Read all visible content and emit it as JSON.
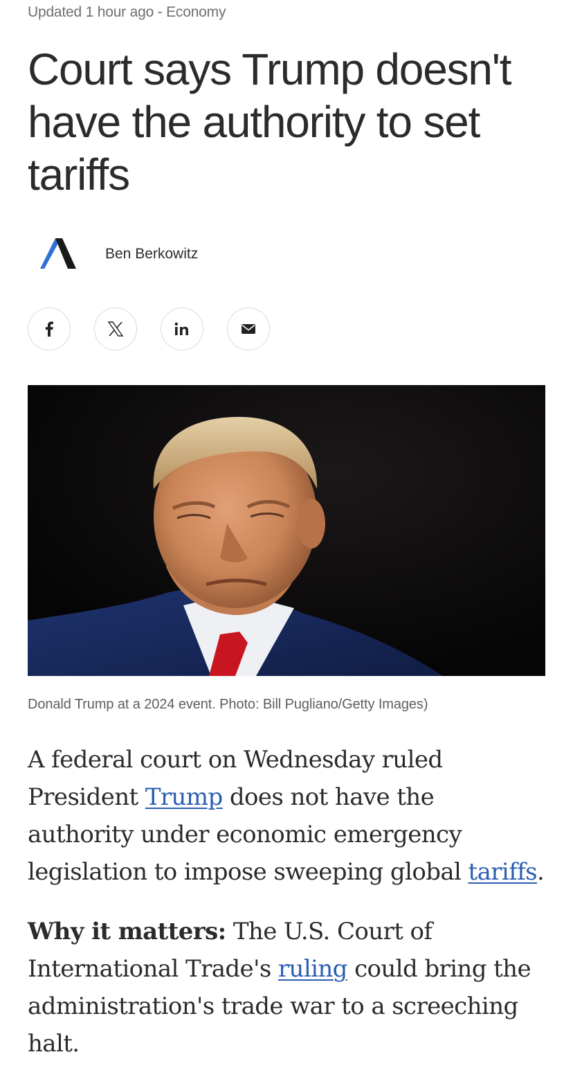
{
  "article": {
    "meta": "Updated 1 hour ago - Economy",
    "headline": "Court says Trump doesn't have the authority to set tariffs",
    "author": "Ben Berkowitz",
    "caption": "Donald Trump at a 2024 event. Photo: Bill Pugliano/Getty Images)",
    "p1": {
      "a": "A federal court on Wednesday ruled President ",
      "link1": "Trump",
      "b": " does not have the authority under economic emergency legislation to impose sweeping global ",
      "link2": "tariffs",
      "c": "."
    },
    "p2": {
      "lead": "Why it matters:",
      "a": " The U.S. Court of International Trade's ",
      "link": "ruling",
      "b": " could bring the administration's trade war to a screeching halt."
    }
  },
  "share": {
    "buttons": [
      {
        "icon": "facebook-icon"
      },
      {
        "icon": "x-icon"
      },
      {
        "icon": "linkedin-icon"
      },
      {
        "icon": "email-icon"
      }
    ]
  },
  "colors": {
    "link": "#2a5db0",
    "text": "#2b2b2b",
    "meta": "#6f6f6f",
    "logo_blue": "#2f6fd8"
  }
}
